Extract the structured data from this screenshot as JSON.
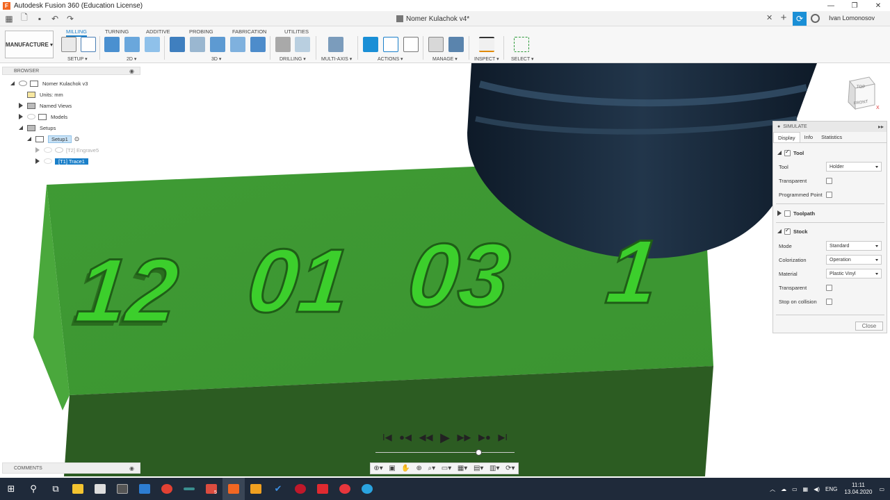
{
  "window": {
    "title": "Autodesk Fusion 360 (Education License)",
    "controls": [
      "—",
      "❐",
      "✕"
    ]
  },
  "document": {
    "tab_title": "Nomer Kulachok v4*",
    "user": "Ivan Lomonosov"
  },
  "toolbar": {
    "workspace": "MANUFACTURE ▾",
    "tabs": [
      "MILLING",
      "TURNING",
      "ADDITIVE",
      "PROBING",
      "FABRICATION",
      "UTILITIES"
    ],
    "groups": [
      "SETUP ▾",
      "2D ▾",
      "3D ▾",
      "DRILLING ▾",
      "MULTI-AXIS ▾",
      "ACTIONS ▾",
      "MANAGE ▾",
      "INSPECT ▾",
      "SELECT ▾"
    ]
  },
  "browser": {
    "header": "BROWSER",
    "items": [
      {
        "label": "Nomer Kulachok v3"
      },
      {
        "label": "Units: mm"
      },
      {
        "label": "Named Views"
      },
      {
        "label": "Models"
      },
      {
        "label": "Setups"
      },
      {
        "label": "Setup1"
      },
      {
        "label": "[T2] Engrave5"
      },
      {
        "label": "[T1] Trace1"
      }
    ]
  },
  "comments": {
    "label": "COMMENTS"
  },
  "viewcube": {
    "top": "TOP",
    "front": "FRONT",
    "x": "X"
  },
  "model": {
    "engraving": [
      "12",
      "01",
      "03",
      "1"
    ],
    "block_color": "#3d9c32",
    "text_color": "#3ccf2c",
    "tool_color": "#1a2a3c"
  },
  "simulate": {
    "header": "SIMULATE",
    "tabs": [
      "Display",
      "Info",
      "Statistics"
    ],
    "tool_section": "Tool",
    "tool_label": "Tool",
    "tool_value": "Holder",
    "transparent_label": "Transparent",
    "programmed_point_label": "Programmed Point",
    "toolpath_section": "Toolpath",
    "stock_section": "Stock",
    "mode_label": "Mode",
    "mode_value": "Standard",
    "colorization_label": "Colorization",
    "colorization_value": "Operation",
    "material_label": "Material",
    "material_value": "Plastic Vinyl",
    "transparent2_label": "Transparent",
    "stop_label": "Stop on collision",
    "close": "Close"
  },
  "playback": {
    "buttons": [
      "I◀",
      "●◀",
      "◀◀",
      "▶",
      "▶▶",
      "▶●",
      "▶I"
    ]
  },
  "taskbar": {
    "lang": "ENG",
    "time": "11:11",
    "date": "13.04.2020",
    "badge": "5"
  }
}
